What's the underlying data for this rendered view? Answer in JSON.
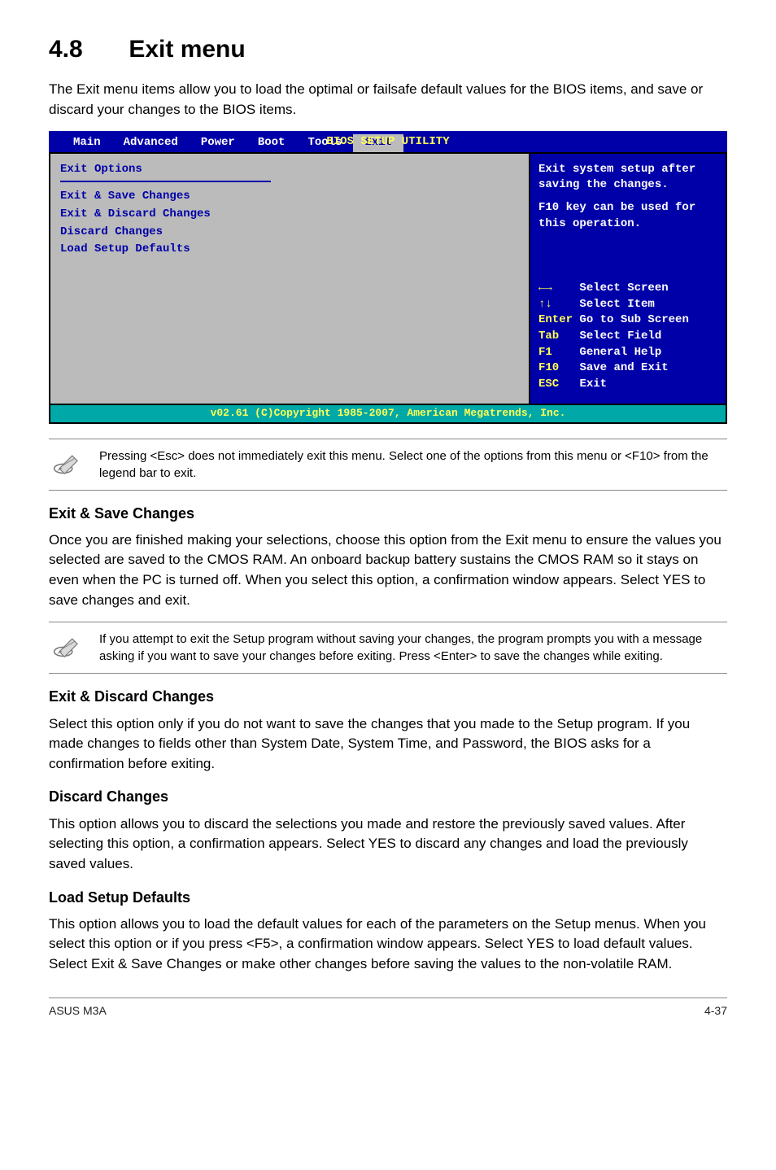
{
  "header": {
    "number": "4.8",
    "title": "Exit menu"
  },
  "intro": "The Exit menu items allow you to load the optimal or failsafe default values for the BIOS items, and save or discard your changes to the BIOS items.",
  "bios": {
    "utility_title": "BIOS SETUP UTILITY",
    "tabs": [
      "Main",
      "Advanced",
      "Power",
      "Boot",
      "Tools",
      "Exit"
    ],
    "active_tab": "Exit",
    "left": {
      "heading": "Exit Options",
      "items": [
        "Exit & Save Changes",
        "Exit & Discard Changes",
        "Discard Changes",
        "",
        "Load Setup Defaults"
      ]
    },
    "right": {
      "desc1": "Exit system setup after saving the changes.",
      "desc2": "F10 key can be used for this operation.",
      "help": {
        "l1a": "",
        "l1b": "Select Screen",
        "l2a": "",
        "l2b": "Select Item",
        "l3a": "Enter",
        "l3b": "Go to Sub Screen",
        "l4a": "Tab",
        "l4b": "Select Field",
        "l5a": "F1",
        "l5b": "General Help",
        "l6a": "F10",
        "l6b": "Save and Exit",
        "l7a": "ESC",
        "l7b": "Exit"
      }
    },
    "footer": "v02.61 (C)Copyright 1985-2007, American Megatrends, Inc."
  },
  "note1": "Pressing <Esc> does not immediately exit this menu. Select one of the options from this menu or <F10> from the legend bar to exit.",
  "sections": {
    "save": {
      "title": "Exit & Save Changes",
      "body": "Once you are finished making your selections, choose this option from the Exit menu to ensure the values you selected are saved to the CMOS RAM. An onboard backup battery sustains the CMOS RAM so it stays on even when the PC is turned off. When you select this option, a confirmation window appears. Select YES to save changes and exit."
    },
    "save_note": " If you attempt to exit the Setup program without saving your changes, the program prompts you with a message asking if you want to save your changes before exiting. Press <Enter>  to save the  changes while exiting.",
    "discard": {
      "title": "Exit & Discard Changes",
      "body": "Select this option only if you do not want to save the changes that you  made to the Setup program. If you made changes to fields other than System Date, System Time, and Password, the BIOS asks for a confirmation before exiting."
    },
    "discard_only": {
      "title": "Discard Changes",
      "body": "This option allows you to discard the selections you made and restore the previously saved values. After selecting this option, a confirmation appears. Select YES to discard any changes and load the previously saved values."
    },
    "defaults": {
      "title": "Load Setup Defaults",
      "body": "This option allows you to load the default values for each of the parameters on the Setup menus. When you select this option or if you press <F5>, a confirmation window appears. Select YES to load default values. Select Exit & Save Changes or make other changes before saving the values to the non-volatile RAM."
    }
  },
  "footer": {
    "left": "ASUS M3A",
    "right": "4-37"
  }
}
